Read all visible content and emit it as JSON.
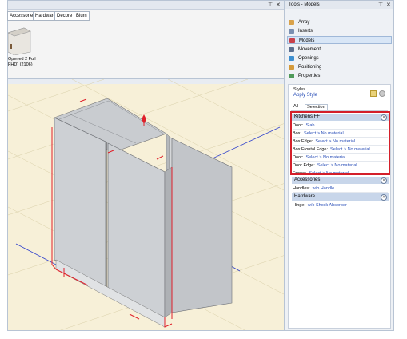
{
  "catalog": {
    "tabs": [
      "Accessories",
      "Hardware",
      "Decore",
      "Blum"
    ],
    "item_label_line1": "Opened 2 Full",
    "item_label_line2": "FHD) (2106)",
    "pin": "⊤",
    "close": "✕"
  },
  "tools": {
    "title": "Tools - Models",
    "pin": "⊤",
    "close": "✕",
    "items": [
      {
        "label": "Array",
        "icon_color": "#d9a24a"
      },
      {
        "label": "Inserts",
        "icon_color": "#7a8fb0"
      },
      {
        "label": "Models",
        "icon_color": "#c8404a"
      },
      {
        "label": "Movement",
        "icon_color": "#5a6f8f"
      },
      {
        "label": "Openings",
        "icon_color": "#3d8fd0"
      },
      {
        "label": "Positioning",
        "icon_color": "#d49a3a"
      },
      {
        "label": "Properties",
        "icon_color": "#4f9a5a"
      }
    ]
  },
  "styles": {
    "label": "Styles",
    "apply": "Apply Style",
    "tab_all": "All",
    "tab_selection": "Selection",
    "kitchens_ff": {
      "title": "Kitchens FF",
      "rows": [
        {
          "key": "Door:",
          "value": "Slab"
        },
        {
          "key": "Box:",
          "value": "Select > No material"
        },
        {
          "key": "Box Edge:",
          "value": "Select > No material"
        },
        {
          "key": "Box Frontal Edge:",
          "value": "Select > No material"
        },
        {
          "key": "Door:",
          "value": "Select > No material"
        },
        {
          "key": "Door Edge:",
          "value": "Select > No material"
        },
        {
          "key": "Frame:",
          "value": "Select > No material"
        }
      ]
    },
    "accessories": {
      "title": "Accessories",
      "rows": [
        {
          "key": "Handles:",
          "value": "w/o Handle"
        }
      ]
    },
    "hardware": {
      "title": "Hardware",
      "rows": [
        {
          "key": "Hinge:",
          "value": "w/o Shock Absorber"
        }
      ]
    }
  },
  "colors": {
    "highlight": "#d41f2a",
    "link": "#2a4fb8",
    "section": "#c8d6ea"
  }
}
